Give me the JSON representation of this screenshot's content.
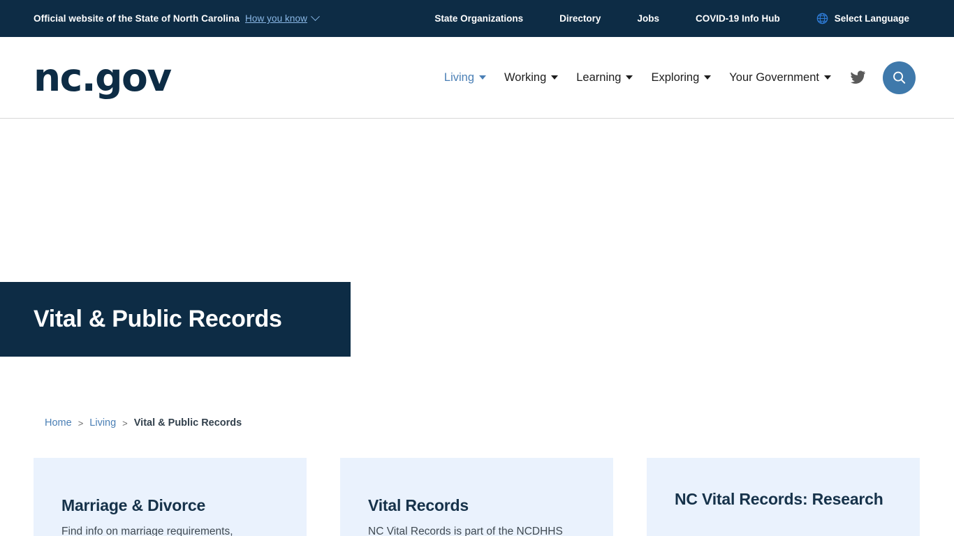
{
  "topbar": {
    "official_text": "Official website of the State of North Carolina",
    "how_you_know": "How you know",
    "chevron_icon": "chevron-down-icon",
    "links": [
      {
        "label": "State Organizations"
      },
      {
        "label": "Directory"
      },
      {
        "label": "Jobs"
      },
      {
        "label": "COVID-19 Info Hub"
      }
    ],
    "language": {
      "icon": "globe-icon",
      "label": "Select Language"
    },
    "background_color": "#0d2c45",
    "link_color": "#8ab8e6"
  },
  "header": {
    "brand": "nc.gov",
    "nav": [
      {
        "label": "Living",
        "active": true
      },
      {
        "label": "Working",
        "active": false
      },
      {
        "label": "Learning",
        "active": false
      },
      {
        "label": "Exploring",
        "active": false
      },
      {
        "label": "Your Government",
        "active": false
      }
    ],
    "twitter_icon": "twitter-icon",
    "search_icon": "search-icon",
    "search_button_color": "#3f79ab",
    "active_nav_color": "#4a7fb5"
  },
  "page": {
    "title": "Vital & Public Records",
    "title_banner_color": "#0d2c45",
    "breadcrumb": [
      {
        "label": "Home",
        "current": false
      },
      {
        "label": "Living",
        "current": false
      },
      {
        "label": "Vital & Public Records",
        "current": true
      }
    ],
    "breadcrumb_separator": ">",
    "cards": [
      {
        "title": "Marriage & Divorce",
        "description": "Find info on marriage requirements,"
      },
      {
        "title": "Vital Records",
        "description": "NC Vital Records is part of the NCDHHS"
      },
      {
        "title": "NC Vital Records: Research",
        "description": ""
      }
    ],
    "card_background_color": "#eaf2fd"
  }
}
